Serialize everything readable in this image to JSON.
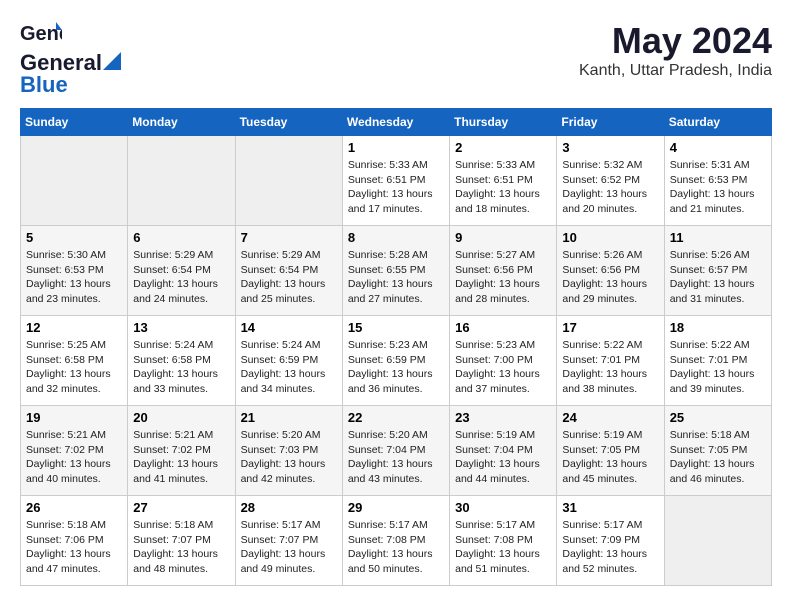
{
  "header": {
    "logo_general": "General",
    "logo_blue": "Blue",
    "month": "May 2024",
    "location": "Kanth, Uttar Pradesh, India"
  },
  "days_of_week": [
    "Sunday",
    "Monday",
    "Tuesday",
    "Wednesday",
    "Thursday",
    "Friday",
    "Saturday"
  ],
  "weeks": [
    [
      {
        "day": "",
        "info": ""
      },
      {
        "day": "",
        "info": ""
      },
      {
        "day": "",
        "info": ""
      },
      {
        "day": "1",
        "info": "Sunrise: 5:33 AM\nSunset: 6:51 PM\nDaylight: 13 hours\nand 17 minutes."
      },
      {
        "day": "2",
        "info": "Sunrise: 5:33 AM\nSunset: 6:51 PM\nDaylight: 13 hours\nand 18 minutes."
      },
      {
        "day": "3",
        "info": "Sunrise: 5:32 AM\nSunset: 6:52 PM\nDaylight: 13 hours\nand 20 minutes."
      },
      {
        "day": "4",
        "info": "Sunrise: 5:31 AM\nSunset: 6:53 PM\nDaylight: 13 hours\nand 21 minutes."
      }
    ],
    [
      {
        "day": "5",
        "info": "Sunrise: 5:30 AM\nSunset: 6:53 PM\nDaylight: 13 hours\nand 23 minutes."
      },
      {
        "day": "6",
        "info": "Sunrise: 5:29 AM\nSunset: 6:54 PM\nDaylight: 13 hours\nand 24 minutes."
      },
      {
        "day": "7",
        "info": "Sunrise: 5:29 AM\nSunset: 6:54 PM\nDaylight: 13 hours\nand 25 minutes."
      },
      {
        "day": "8",
        "info": "Sunrise: 5:28 AM\nSunset: 6:55 PM\nDaylight: 13 hours\nand 27 minutes."
      },
      {
        "day": "9",
        "info": "Sunrise: 5:27 AM\nSunset: 6:56 PM\nDaylight: 13 hours\nand 28 minutes."
      },
      {
        "day": "10",
        "info": "Sunrise: 5:26 AM\nSunset: 6:56 PM\nDaylight: 13 hours\nand 29 minutes."
      },
      {
        "day": "11",
        "info": "Sunrise: 5:26 AM\nSunset: 6:57 PM\nDaylight: 13 hours\nand 31 minutes."
      }
    ],
    [
      {
        "day": "12",
        "info": "Sunrise: 5:25 AM\nSunset: 6:58 PM\nDaylight: 13 hours\nand 32 minutes."
      },
      {
        "day": "13",
        "info": "Sunrise: 5:24 AM\nSunset: 6:58 PM\nDaylight: 13 hours\nand 33 minutes."
      },
      {
        "day": "14",
        "info": "Sunrise: 5:24 AM\nSunset: 6:59 PM\nDaylight: 13 hours\nand 34 minutes."
      },
      {
        "day": "15",
        "info": "Sunrise: 5:23 AM\nSunset: 6:59 PM\nDaylight: 13 hours\nand 36 minutes."
      },
      {
        "day": "16",
        "info": "Sunrise: 5:23 AM\nSunset: 7:00 PM\nDaylight: 13 hours\nand 37 minutes."
      },
      {
        "day": "17",
        "info": "Sunrise: 5:22 AM\nSunset: 7:01 PM\nDaylight: 13 hours\nand 38 minutes."
      },
      {
        "day": "18",
        "info": "Sunrise: 5:22 AM\nSunset: 7:01 PM\nDaylight: 13 hours\nand 39 minutes."
      }
    ],
    [
      {
        "day": "19",
        "info": "Sunrise: 5:21 AM\nSunset: 7:02 PM\nDaylight: 13 hours\nand 40 minutes."
      },
      {
        "day": "20",
        "info": "Sunrise: 5:21 AM\nSunset: 7:02 PM\nDaylight: 13 hours\nand 41 minutes."
      },
      {
        "day": "21",
        "info": "Sunrise: 5:20 AM\nSunset: 7:03 PM\nDaylight: 13 hours\nand 42 minutes."
      },
      {
        "day": "22",
        "info": "Sunrise: 5:20 AM\nSunset: 7:04 PM\nDaylight: 13 hours\nand 43 minutes."
      },
      {
        "day": "23",
        "info": "Sunrise: 5:19 AM\nSunset: 7:04 PM\nDaylight: 13 hours\nand 44 minutes."
      },
      {
        "day": "24",
        "info": "Sunrise: 5:19 AM\nSunset: 7:05 PM\nDaylight: 13 hours\nand 45 minutes."
      },
      {
        "day": "25",
        "info": "Sunrise: 5:18 AM\nSunset: 7:05 PM\nDaylight: 13 hours\nand 46 minutes."
      }
    ],
    [
      {
        "day": "26",
        "info": "Sunrise: 5:18 AM\nSunset: 7:06 PM\nDaylight: 13 hours\nand 47 minutes."
      },
      {
        "day": "27",
        "info": "Sunrise: 5:18 AM\nSunset: 7:07 PM\nDaylight: 13 hours\nand 48 minutes."
      },
      {
        "day": "28",
        "info": "Sunrise: 5:17 AM\nSunset: 7:07 PM\nDaylight: 13 hours\nand 49 minutes."
      },
      {
        "day": "29",
        "info": "Sunrise: 5:17 AM\nSunset: 7:08 PM\nDaylight: 13 hours\nand 50 minutes."
      },
      {
        "day": "30",
        "info": "Sunrise: 5:17 AM\nSunset: 7:08 PM\nDaylight: 13 hours\nand 51 minutes."
      },
      {
        "day": "31",
        "info": "Sunrise: 5:17 AM\nSunset: 7:09 PM\nDaylight: 13 hours\nand 52 minutes."
      },
      {
        "day": "",
        "info": ""
      }
    ]
  ]
}
